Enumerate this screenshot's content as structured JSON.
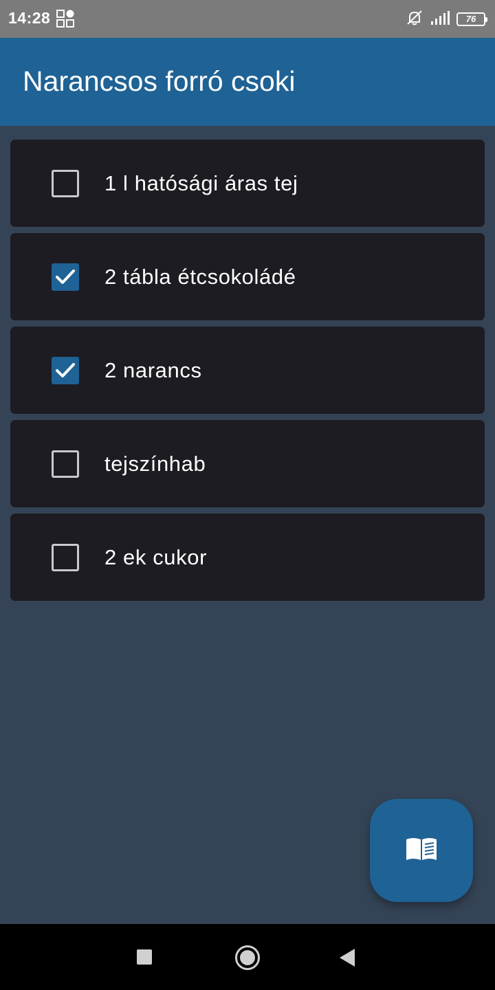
{
  "status_bar": {
    "time": "14:28",
    "battery_level": "76",
    "icons": [
      "app-grid-icon",
      "silent-icon",
      "signal-icon",
      "battery-icon"
    ]
  },
  "app_bar": {
    "title": "Narancsos forró csoki"
  },
  "items": [
    {
      "label": "1 l hatósági áras tej",
      "checked": false
    },
    {
      "label": "2 tábla étcsokoládé",
      "checked": true
    },
    {
      "label": "2 narancs",
      "checked": true
    },
    {
      "label": "tejszínhab",
      "checked": false
    },
    {
      "label": "2 ek cukor",
      "checked": false
    }
  ],
  "fab": {
    "icon": "open-book-icon"
  },
  "nav_bar": {
    "icons": [
      "recents-icon",
      "home-icon",
      "back-icon"
    ]
  },
  "colors": {
    "accent": "#1f6295",
    "background": "#344456",
    "card": "#1d1c22",
    "status_bar": "#7b7b7b"
  }
}
